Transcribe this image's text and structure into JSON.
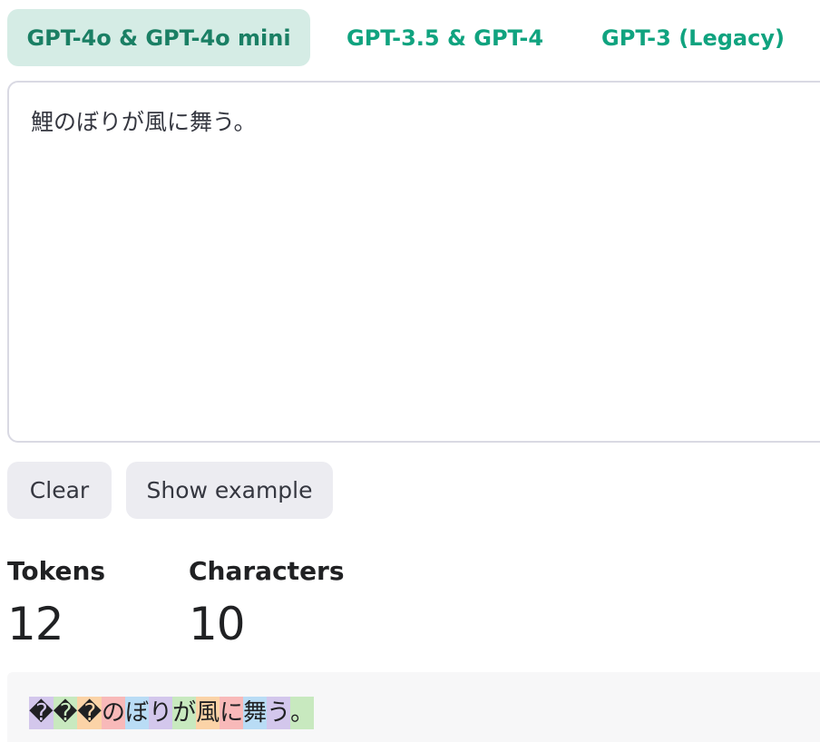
{
  "tabs": [
    {
      "label": "GPT-4o & GPT-4o mini",
      "active": true
    },
    {
      "label": "GPT-3.5 & GPT-4",
      "active": false
    },
    {
      "label": "GPT-3 (Legacy)",
      "active": false
    }
  ],
  "input": {
    "value": "鯉のぼりが風に舞う。"
  },
  "buttons": {
    "clear": "Clear",
    "show_example": "Show example"
  },
  "stats": {
    "tokens_label": "Tokens",
    "tokens_value": "12",
    "characters_label": "Characters",
    "characters_value": "10"
  },
  "tokens": [
    {
      "text": "�",
      "color": "#d3c7ec"
    },
    {
      "text": "�",
      "color": "#c8e9bf"
    },
    {
      "text": "�",
      "color": "#fbd3a7"
    },
    {
      "text": "の",
      "color": "#f8b9b9"
    },
    {
      "text": "ぼ",
      "color": "#b9dcf5"
    },
    {
      "text": "り",
      "color": "#d3c7ec"
    },
    {
      "text": "が",
      "color": "#c8e9bf"
    },
    {
      "text": "風",
      "color": "#fbd3a7"
    },
    {
      "text": "に",
      "color": "#f8b9b9"
    },
    {
      "text": "舞",
      "color": "#b9dcf5"
    },
    {
      "text": "う",
      "color": "#d3c7ec"
    },
    {
      "text": "。",
      "color": "#c8e9bf"
    }
  ],
  "colors": {
    "accent": "#10a37f",
    "active_tab_bg": "#d5ece5"
  }
}
